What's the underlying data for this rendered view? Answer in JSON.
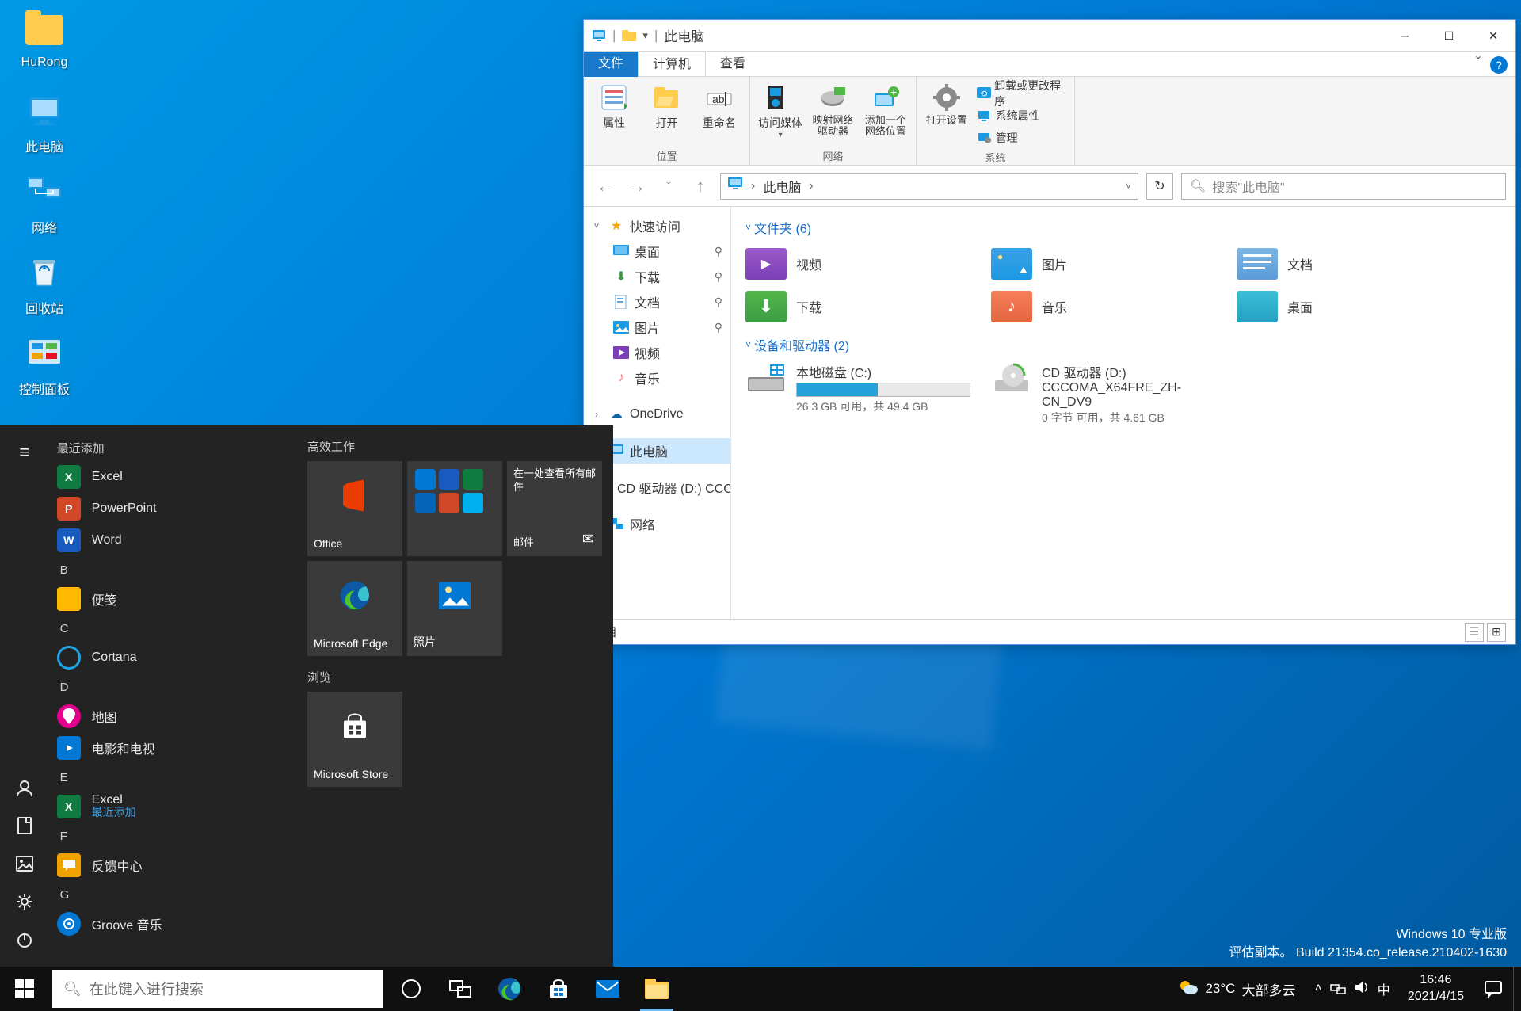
{
  "desktop": {
    "icons": [
      {
        "label": "HuRong"
      },
      {
        "label": "此电脑"
      },
      {
        "label": "网络"
      },
      {
        "label": "回收站"
      },
      {
        "label": "控制面板"
      }
    ],
    "watermark": {
      "line1": "Windows 10 专业版",
      "line2": "评估副本。 Build 21354.co_release.210402-1630"
    }
  },
  "explorer": {
    "title": "此电脑",
    "tabs": {
      "file": "文件",
      "computer": "计算机",
      "view": "查看"
    },
    "ribbon": {
      "group_location": "位置",
      "group_network": "网络",
      "group_system": "系统",
      "properties": "属性",
      "open": "打开",
      "rename": "重命名",
      "access_media": "访问媒体",
      "map_drive": "映射网络驱动器",
      "add_loc": "添加一个网络位置",
      "open_settings": "打开设置",
      "uninstall": "卸载或更改程序",
      "sysprops": "系统属性",
      "manage": "管理"
    },
    "addr": {
      "crumb_root": "此电脑"
    },
    "search_placeholder": "搜索\"此电脑\"",
    "nav": {
      "quick": "快速访问",
      "desktop": "桌面",
      "downloads": "下载",
      "documents": "文档",
      "pictures": "图片",
      "videos": "视频",
      "music": "音乐",
      "onedrive": "OneDrive",
      "thispc": "此电脑",
      "cd": "CD 驱动器 (D:) CCC",
      "network": "网络"
    },
    "content": {
      "folders_header": "文件夹 (6)",
      "drives_header": "设备和驱动器 (2)",
      "folders": [
        {
          "name": "视频"
        },
        {
          "name": "图片"
        },
        {
          "name": "文档"
        },
        {
          "name": "下载"
        },
        {
          "name": "音乐"
        },
        {
          "name": "桌面"
        }
      ],
      "drives": [
        {
          "name": "本地磁盘 (C:)",
          "sub": "26.3 GB 可用，共 49.4 GB",
          "fill": 47
        },
        {
          "name": "CD 驱动器 (D:)",
          "name2": "CCCOMA_X64FRE_ZH-CN_DV9",
          "sub": "0 字节 可用，共 4.61 GB"
        }
      ]
    },
    "status": {
      "left": "项目"
    }
  },
  "start": {
    "recent_h": "最近添加",
    "productive_h": "高效工作",
    "browse_h": "浏览",
    "apps": [
      {
        "label": "Excel",
        "color": "#107c41",
        "abbr": "X"
      },
      {
        "label": "PowerPoint",
        "color": "#d24726",
        "abbr": "P"
      },
      {
        "label": "Word",
        "color": "#185abd",
        "abbr": "W"
      }
    ],
    "letter_b": "B",
    "b_items": [
      {
        "label": "便笺",
        "color": "#ffb900"
      }
    ],
    "letter_c": "C",
    "c_items": [
      {
        "label": "Cortana",
        "ring": true
      }
    ],
    "letter_d": "D",
    "d_items": [
      {
        "label": "地图",
        "color": "#e3008c"
      },
      {
        "label": "电影和电视",
        "color": "#0078d4"
      }
    ],
    "letter_e": "E",
    "e_items": [
      {
        "label": "Excel",
        "sub": "最近添加",
        "color": "#107c41",
        "abbr": "X"
      }
    ],
    "letter_f": "F",
    "f_items": [
      {
        "label": "反馈中心",
        "color": "#f2a100"
      }
    ],
    "letter_g": "G",
    "g_items": [
      {
        "label": "Groove 音乐",
        "color": "#0078d4"
      }
    ],
    "tiles": {
      "office": "Office",
      "edge": "Microsoft Edge",
      "photos": "照片",
      "mail_top": "在一处查看所有邮件",
      "mail_bottom": "邮件",
      "store": "Microsoft Store"
    }
  },
  "taskbar": {
    "search_placeholder": "在此键入进行搜索",
    "weather": {
      "temp": "23°C",
      "desc": "大部多云"
    },
    "ime": "中",
    "time": "16:46",
    "date": "2021/4/15"
  }
}
